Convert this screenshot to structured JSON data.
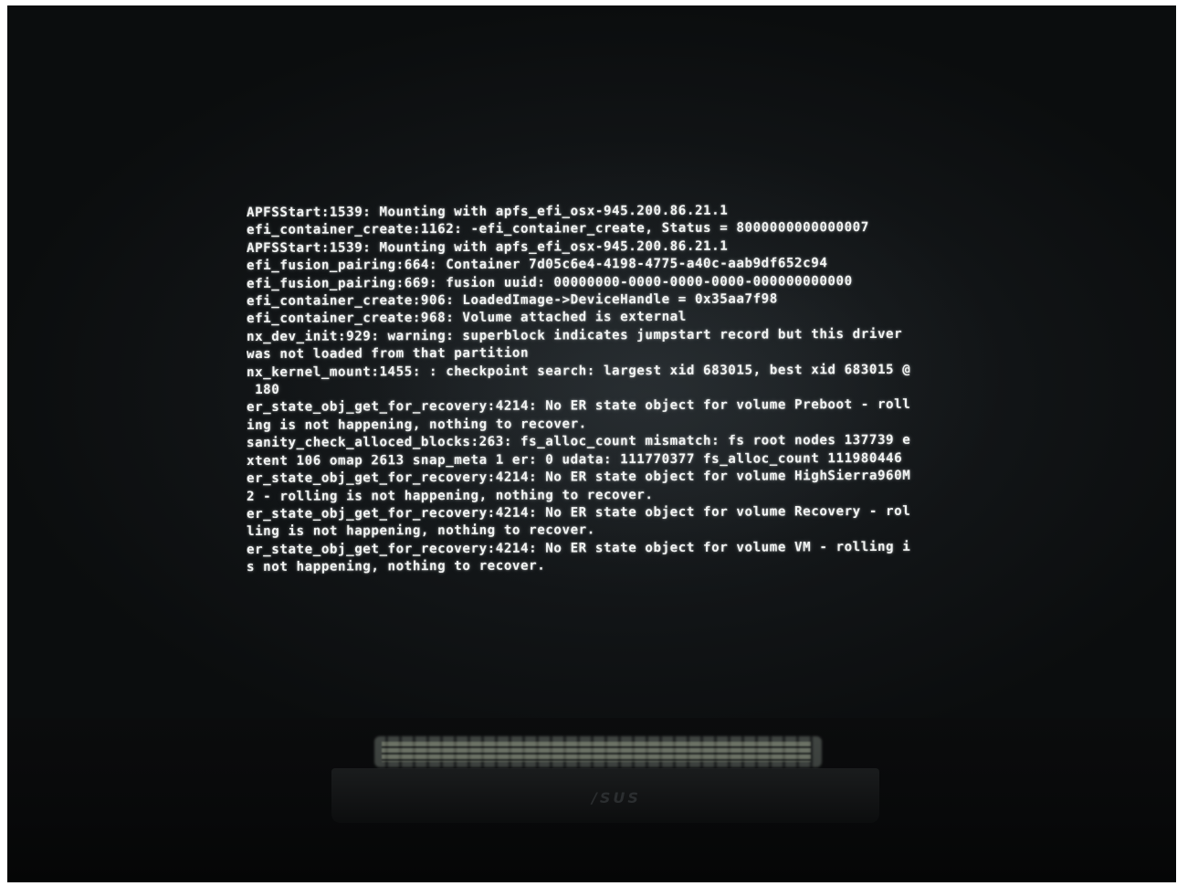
{
  "console": {
    "lines": [
      "APFSStart:1539: Mounting with apfs_efi_osx-945.200.86.21.1",
      "efi_container_create:1162: -efi_container_create, Status = 8000000000000007",
      "APFSStart:1539: Mounting with apfs_efi_osx-945.200.86.21.1",
      "efi_fusion_pairing:664: Container 7d05c6e4-4198-4775-a40c-aab9df652c94",
      "efi_fusion_pairing:669: fusion uuid: 00000000-0000-0000-0000-000000000000",
      "efi_container_create:906: LoadedImage->DeviceHandle = 0x35aa7f98",
      "efi_container_create:968: Volume attached is external",
      "nx_dev_init:929: warning: superblock indicates jumpstart record but this driver",
      "was not loaded from that partition",
      "nx_kernel_mount:1455: : checkpoint search: largest xid 683015, best xid 683015 @",
      " 180",
      "er_state_obj_get_for_recovery:4214: No ER state object for volume Preboot - roll",
      "ing is not happening, nothing to recover.",
      "sanity_check_alloced_blocks:263: fs_alloc_count mismatch: fs root nodes 137739 e",
      "xtent 106 omap 2613 snap_meta 1 er: 0 udata: 111770377 fs_alloc_count 111980446",
      "er_state_obj_get_for_recovery:4214: No ER state object for volume HighSierra960M",
      "2 - rolling is not happening, nothing to recover.",
      "er_state_obj_get_for_recovery:4214: No ER state object for volume Recovery - rol",
      "ling is not happening, nothing to recover.",
      "er_state_obj_get_for_recovery:4214: No ER state object for volume VM - rolling i",
      "s not happening, nothing to recover."
    ]
  },
  "monitor": {
    "brand": "/SUS"
  },
  "colors": {
    "console_text": "#f2f4f3",
    "screen_background": "#121517"
  }
}
